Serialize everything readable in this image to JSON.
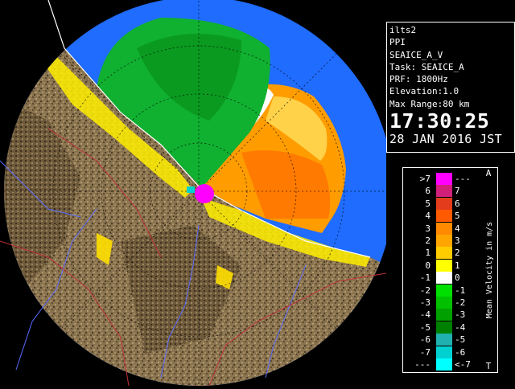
{
  "radar": {
    "station": "ilts2",
    "product": "PPI",
    "product_name": "SEAICE_A_V",
    "task": "Task: SEAICE_A",
    "prf": "PRF: 1800Hz",
    "elevation": "Elevation:1.0",
    "max_range": "Max Range:80 km",
    "time": "17:30:25",
    "date": "28 JAN 2016 JST"
  },
  "legend": {
    "title": "Mean Velocity in m/s",
    "top_marker": "A",
    "bottom_marker": "T",
    "rows": [
      {
        "left": ">7",
        "right": "---",
        "color": "#ff00ff"
      },
      {
        "left": "6",
        "right": "7",
        "color": "#d0207a"
      },
      {
        "left": "5",
        "right": "6",
        "color": "#e23c1c"
      },
      {
        "left": "4",
        "right": "5",
        "color": "#ff5a00"
      },
      {
        "left": "3",
        "right": "4",
        "color": "#ff8a00"
      },
      {
        "left": "2",
        "right": "3",
        "color": "#ffa500"
      },
      {
        "left": "1",
        "right": "2",
        "color": "#ffcc00"
      },
      {
        "left": "0",
        "right": "1",
        "color": "#ffff00"
      },
      {
        "left": "-1",
        "right": "0",
        "color": "#ffffff"
      },
      {
        "left": "-2",
        "right": "-1",
        "color": "#00e000"
      },
      {
        "left": "-3",
        "right": "-2",
        "color": "#00c000"
      },
      {
        "left": "-4",
        "right": "-3",
        "color": "#00a000"
      },
      {
        "left": "-5",
        "right": "-4",
        "color": "#008000"
      },
      {
        "left": "-6",
        "right": "-5",
        "color": "#20b0b0"
      },
      {
        "left": "-7",
        "right": "-6",
        "color": "#00d0d0"
      },
      {
        "left": "---",
        "right": "<-7",
        "color": "#00ffff"
      }
    ]
  },
  "map_colors": {
    "background": "#000000",
    "range_disk": "#1f6cff",
    "terrain": "#8a7450",
    "coastline": "#ffffff",
    "rivers": "#5a6cff",
    "boundaries": "#c0303a"
  }
}
